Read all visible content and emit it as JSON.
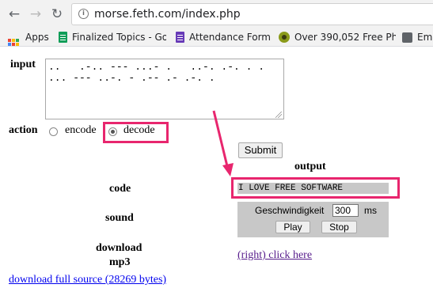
{
  "browser": {
    "nav": {
      "back": "←",
      "forward": "→",
      "reload": "↻"
    },
    "url": "morse.feth.com/index.php",
    "bookmarks": [
      {
        "label": "Apps",
        "icon": "apps-grid-icon"
      },
      {
        "label": "Finalized Topics - Goo",
        "icon": "sheets-icon"
      },
      {
        "label": "Attendance Form",
        "icon": "forms-icon"
      },
      {
        "label": "Over 390,052 Free Ph",
        "icon": "eye-icon"
      },
      {
        "label": "Ema",
        "icon": "mail-icon"
      }
    ]
  },
  "form": {
    "input_label": "input",
    "input_value": "..   .-.. --- ...- .   ..-. .-. . .\n... --- ..-. - .-- .- .-. .",
    "action_label": "action",
    "encode_label": "encode",
    "decode_label": "decode",
    "selected_action": "decode",
    "submit_label": "Submit"
  },
  "output": {
    "heading": "output",
    "code_label": "code",
    "code_value": "I LOVE FREE SOFTWARE",
    "sound_label": "sound",
    "speed_label": "Geschwindigkeit",
    "speed_value": "300",
    "speed_unit": "ms",
    "play_label": "Play",
    "stop_label": "Stop",
    "download_label": "download",
    "mp3_label": "mp3",
    "download_link": "(right) click here"
  },
  "footer": {
    "source_link": "download full source (28269 bytes)"
  },
  "colors": {
    "highlight": "#e8266e",
    "output_bg": "#c8c8c8"
  }
}
